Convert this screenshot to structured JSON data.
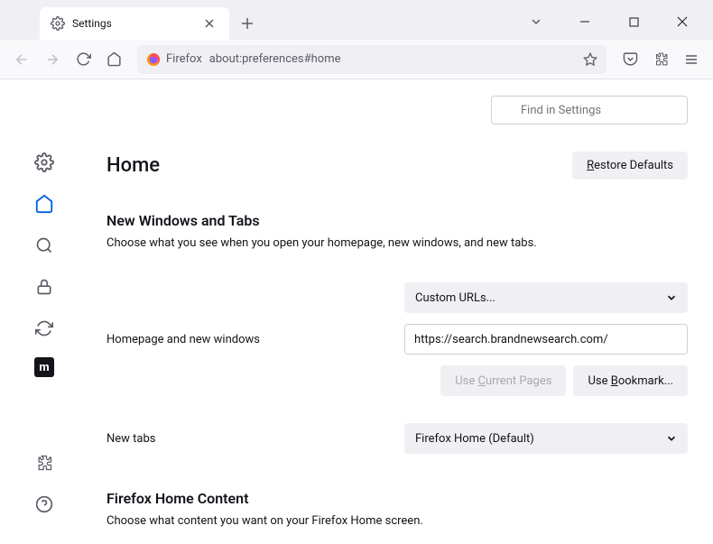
{
  "tab": {
    "title": "Settings"
  },
  "urlbar": {
    "identity": "Firefox",
    "url": "about:preferences#home"
  },
  "search": {
    "placeholder": "Find in Settings"
  },
  "page": {
    "title": "Home",
    "restore": "estore Defaults"
  },
  "section1": {
    "title": "New Windows and Tabs",
    "desc": "Choose what you see when you open your homepage, new windows, and new tabs."
  },
  "homepage": {
    "label": "Homepage and new windows",
    "select": "Custom URLs...",
    "value": "https://search.brandnewsearch.com/",
    "use_current": "urrent Pages",
    "use_bookmark": "ookmark..."
  },
  "newtabs": {
    "label": "New tabs",
    "select": "Firefox Home (Default)"
  },
  "section2": {
    "title": "Firefox Home Content",
    "desc": "Choose what content you want on your Firefox Home screen."
  }
}
